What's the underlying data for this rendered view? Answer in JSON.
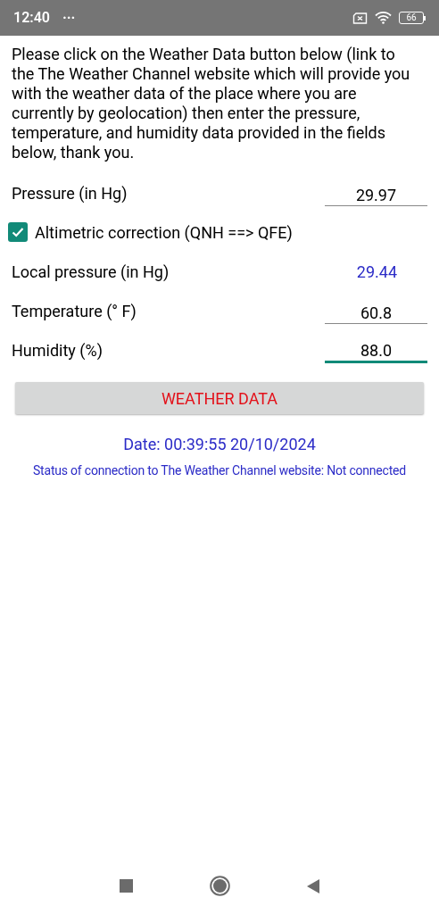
{
  "status_bar": {
    "time": "12:40",
    "more": "···",
    "battery": "66"
  },
  "intro": "Please click on the Weather Data button below (link to the The Weather Channel website which will provide you with the weather data of the place where you are currently by geolocation) then enter the pressure, temperature, and humidity data provided in the fields below, thank you.",
  "rows": [
    {
      "kind": "field",
      "label": "Pressure (in Hg)",
      "value": "29.97",
      "focused": false
    },
    {
      "kind": "checkbox",
      "label": "Altimetric correction (QNH ==> QFE)",
      "checked": true
    },
    {
      "kind": "readout",
      "label": "Local pressure (in Hg)",
      "value": "29.44"
    },
    {
      "kind": "field",
      "label": "Temperature (° F)",
      "value": "60.8",
      "focused": false
    },
    {
      "kind": "field",
      "label": "Humidity (%)",
      "value": "88.0",
      "focused": true
    }
  ],
  "button": "WEATHER DATA",
  "date": "Date: 00:39:55 20/10/2024",
  "connection_status": "Status of connection to The Weather Channel website: Not connected"
}
